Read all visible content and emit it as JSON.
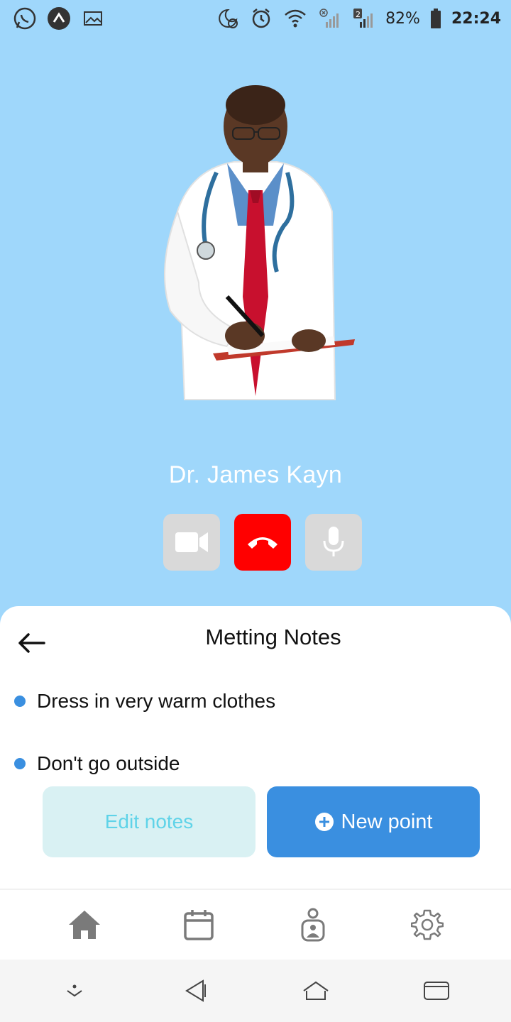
{
  "status_bar": {
    "battery": "82%",
    "time": "22:24",
    "icons": [
      "whatsapp-icon",
      "app-icon",
      "image-icon",
      "night-alarm-icon",
      "alarm-icon",
      "wifi-icon",
      "signal-sim1-icon",
      "signal-sim2-icon",
      "battery-icon"
    ]
  },
  "call": {
    "doctor_name": "Dr. James Kayn",
    "controls": [
      "video-icon",
      "end-call-icon",
      "mic-icon"
    ]
  },
  "notes": {
    "title": "Metting Notes",
    "items": [
      {
        "text": "Dress in very warm clothes"
      },
      {
        "text": "Don't go outside"
      }
    ],
    "edit_label": "Edit notes",
    "new_label": "New point"
  },
  "bottom_nav": {
    "items": [
      "home-icon",
      "calendar-icon",
      "profile-icon",
      "settings-icon"
    ]
  },
  "colors": {
    "hero_background": "#9fd7fb",
    "primary": "#3a8fe0",
    "end_call": "#ff0000",
    "edit_button_bg": "#d9f1f3",
    "edit_button_text": "#5fd3e8"
  }
}
